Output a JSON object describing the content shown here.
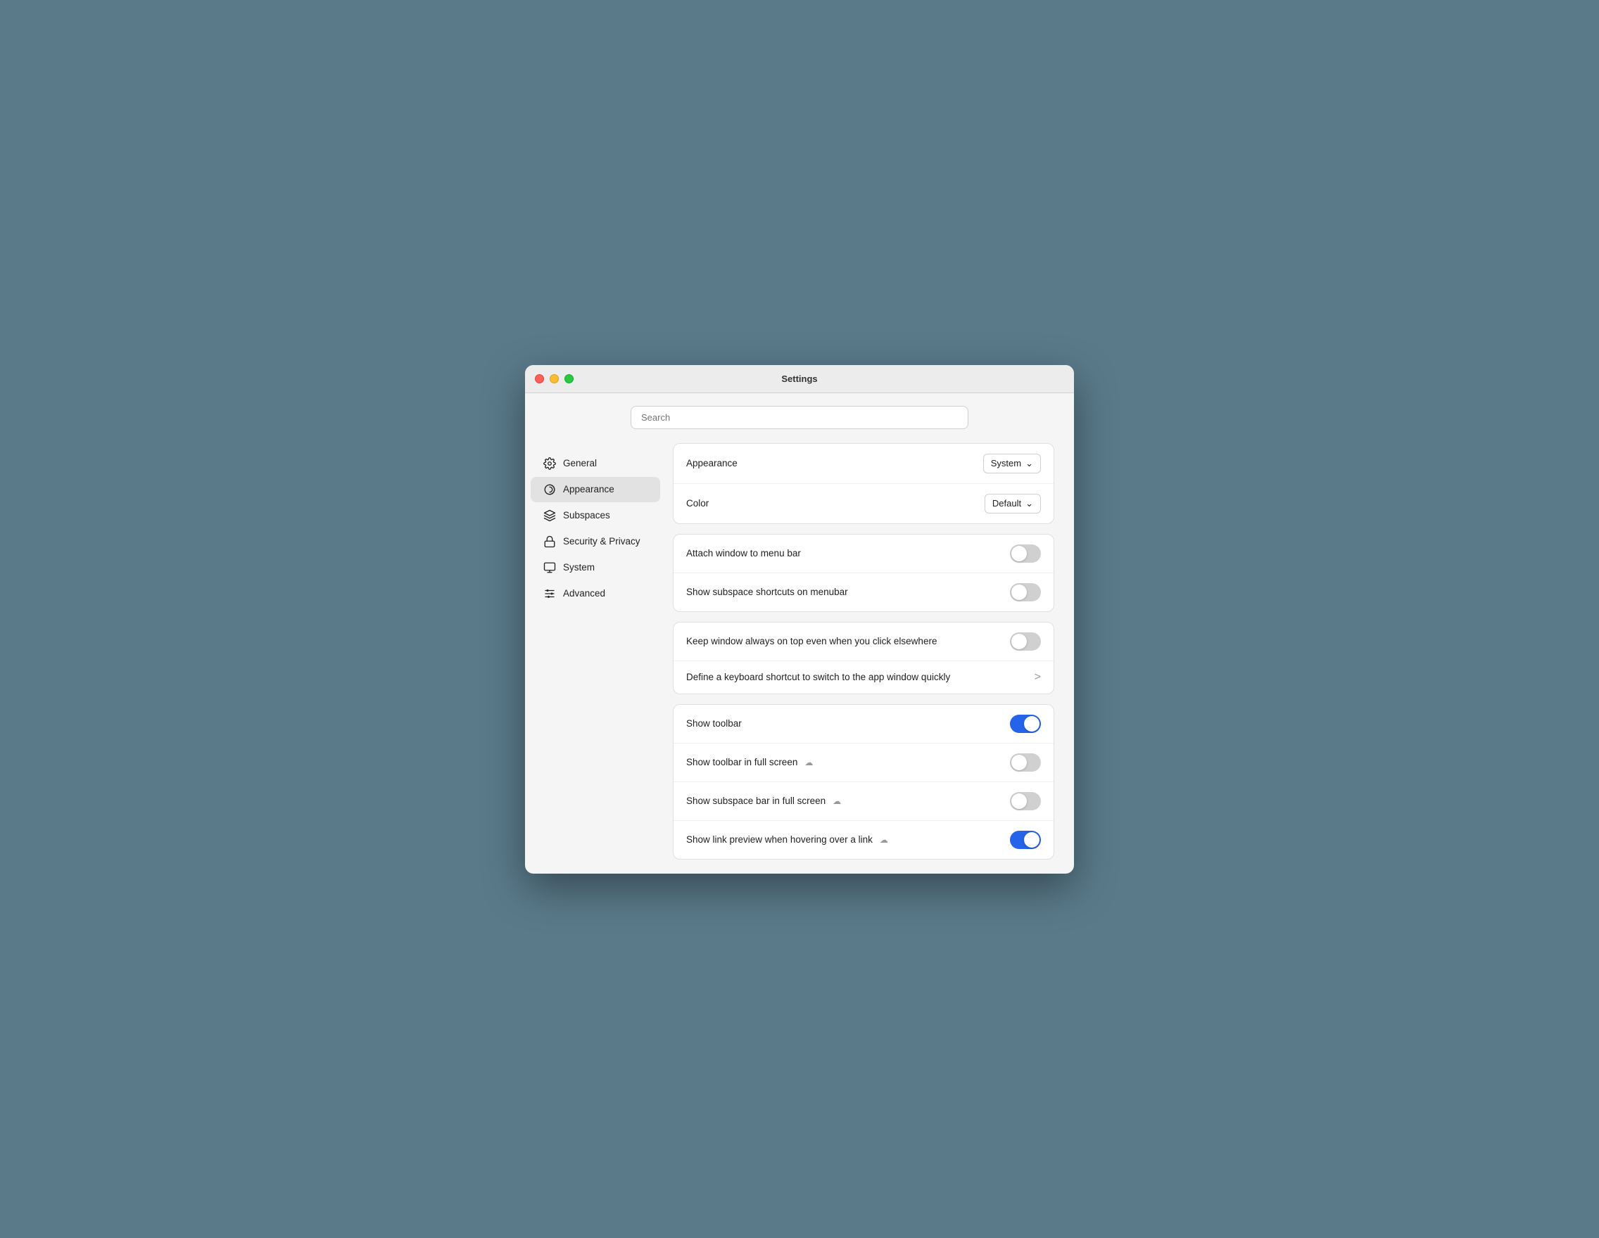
{
  "window": {
    "title": "Settings"
  },
  "search": {
    "placeholder": "Search"
  },
  "sidebar": {
    "items": [
      {
        "id": "general",
        "label": "General",
        "icon": "gear"
      },
      {
        "id": "appearance",
        "label": "Appearance",
        "icon": "appearance",
        "active": true
      },
      {
        "id": "subspaces",
        "label": "Subspaces",
        "icon": "layers"
      },
      {
        "id": "security",
        "label": "Security & Privacy",
        "icon": "lock"
      },
      {
        "id": "system",
        "label": "System",
        "icon": "monitor"
      },
      {
        "id": "advanced",
        "label": "Advanced",
        "icon": "sliders"
      }
    ]
  },
  "appearance_section": {
    "card1": {
      "rows": [
        {
          "label": "Appearance",
          "control": "dropdown",
          "value": "System"
        },
        {
          "label": "Color",
          "control": "dropdown",
          "value": "Default"
        }
      ]
    },
    "card2": {
      "rows": [
        {
          "label": "Attach window to menu bar",
          "control": "toggle",
          "on": false
        },
        {
          "label": "Show subspace shortcuts on menubar",
          "control": "toggle",
          "on": false
        }
      ]
    },
    "card3": {
      "rows": [
        {
          "label": "Keep window always on top even when you click elsewhere",
          "control": "toggle",
          "on": false
        },
        {
          "label": "Define a keyboard shortcut to switch to the app window quickly",
          "control": "chevron"
        }
      ]
    },
    "card4": {
      "rows": [
        {
          "label": "Show toolbar",
          "control": "toggle",
          "on": true,
          "cloud": false
        },
        {
          "label": "Show toolbar in full screen",
          "control": "toggle",
          "on": false,
          "cloud": true
        },
        {
          "label": "Show subspace bar in full screen",
          "control": "toggle",
          "on": false,
          "cloud": true
        },
        {
          "label": "Show link preview when hovering over a link",
          "control": "toggle",
          "on": true,
          "cloud": true
        }
      ]
    }
  }
}
